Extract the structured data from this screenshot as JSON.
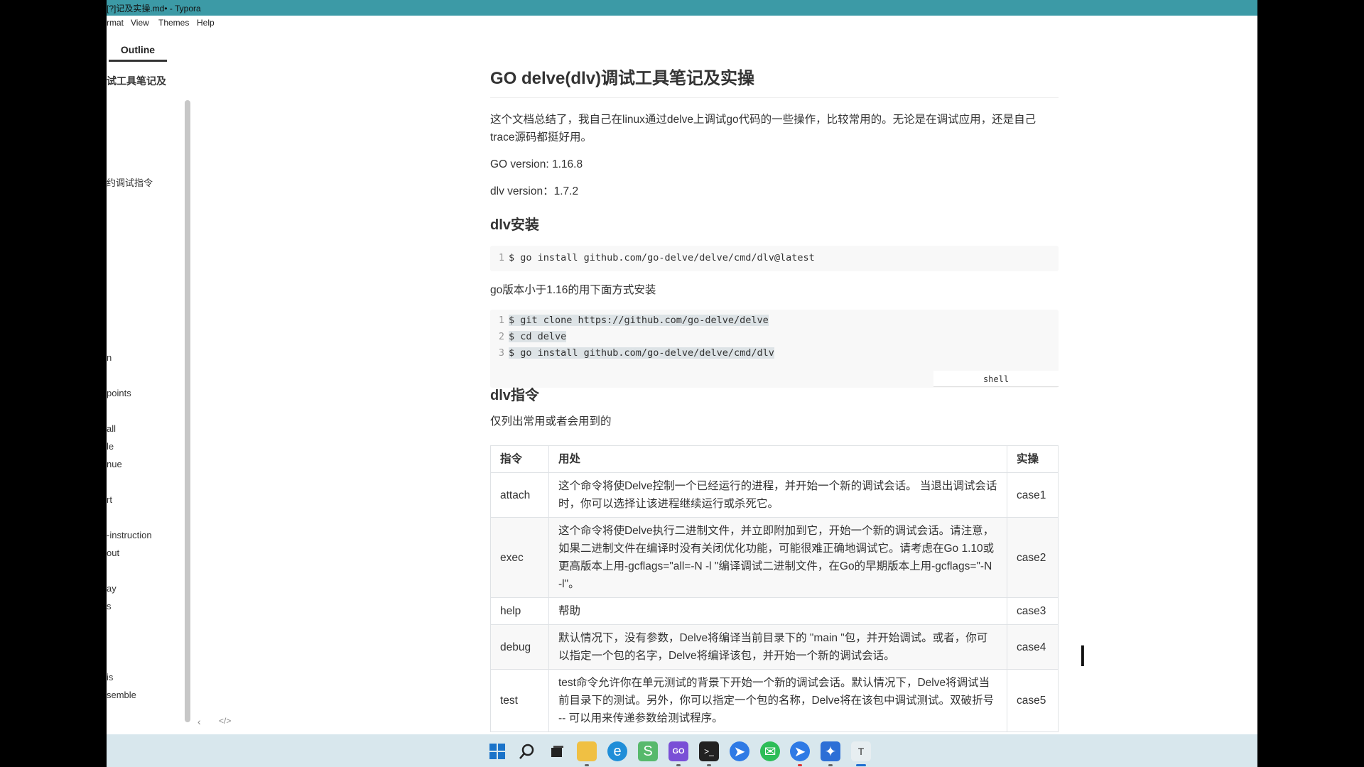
{
  "window": {
    "title": "[?]记及实操.md• - Typora"
  },
  "menu": [
    "rmat",
    "View",
    "Themes",
    "Help"
  ],
  "sidebar": {
    "tab": "Outline",
    "items": [
      {
        "label": "试工具笔记及",
        "level": "h1"
      },
      {
        "label": "约调试指令",
        "level": "h2"
      },
      {
        "label": "n",
        "level": "h3"
      },
      {
        "label": "points",
        "level": "h3"
      },
      {
        "label": "all",
        "level": "h3"
      },
      {
        "label": "le",
        "level": "h3"
      },
      {
        "label": "nue",
        "level": "h3"
      },
      {
        "label": "rt",
        "level": "h3"
      },
      {
        "label": "-instruction",
        "level": "h3"
      },
      {
        "label": "out",
        "level": "h3"
      },
      {
        "label": "ay",
        "level": "h3"
      },
      {
        "label": "s",
        "level": "h3"
      },
      {
        "label": "is",
        "level": "h3"
      },
      {
        "label": "semble",
        "level": "h3"
      }
    ],
    "footer_icons": [
      "chevron-left-icon",
      "code-icon"
    ]
  },
  "document": {
    "title": "GO delve(dlv)调试工具笔记及实操",
    "intro": "这个文档总结了，我自己在linux通过delve上调试go代码的一些操作，比较常用的。无论是在调试应用，还是自己trace源码都挺好用。",
    "go_version": "GO version: 1.16.8",
    "dlv_version": "dlv version：1.7.2",
    "install_heading": "dlv安装",
    "install_code": [
      "$ go install github.com/go-delve/delve/cmd/dlv@latest"
    ],
    "old_version_note": "go版本小于1.16的用下面方式安装",
    "old_install_code": [
      "$ git clone https://github.com/go-delve/delve",
      "$ cd delve",
      "$ go install github.com/go-delve/delve/cmd/dlv"
    ],
    "code_lang": "shell",
    "cmd_heading": "dlv指令",
    "cmd_note": "仅列出常用或者会用到的",
    "table": {
      "headers": [
        "指令",
        "用处",
        "实操"
      ],
      "rows": [
        [
          "attach",
          "这个命令将使Delve控制一个已经运行的进程，并开始一个新的调试会话。 当退出调试会话时，你可以选择让该进程继续运行或杀死它。",
          "case1"
        ],
        [
          "exec",
          "这个命令将使Delve执行二进制文件，并立即附加到它，开始一个新的调试会话。请注意，如果二进制文件在编译时没有关闭优化功能，可能很难正确地调试它。请考虑在Go 1.10或更高版本上用-gcflags=\"all=-N -l \"编译调试二进制文件，在Go的早期版本上用-gcflags=\"-N -l\"。",
          "case2"
        ],
        [
          "help",
          "帮助",
          "case3"
        ],
        [
          "debug",
          "默认情况下，没有参数，Delve将编译当前目录下的 \"main \"包，并开始调试。或者，你可以指定一个包的名字，Delve将编译该包，并开始一个新的调试会话。",
          "case4"
        ],
        [
          "test",
          "test命令允许你在单元测试的背景下开始一个新的调试会话。默认情况下，Delve将调试当前目录下的测试。另外，你可以指定一个包的名称，Delve将在该包中调试测试。双破折号 -- 可以用来传递参数给测试程序。",
          "case5"
        ]
      ]
    }
  },
  "taskbar": {
    "icons": [
      "windows-start-icon",
      "search-icon",
      "task-view-icon",
      "file-explorer-icon",
      "edge-icon",
      "app-icon",
      "goland-icon",
      "terminal-icon",
      "feishu-icon",
      "wechat-icon",
      "vpn-icon",
      "network-icon",
      "typora-icon"
    ],
    "colors": {
      "bg": "#d8e7ed",
      "titlebar": "#3c9aa6"
    }
  }
}
